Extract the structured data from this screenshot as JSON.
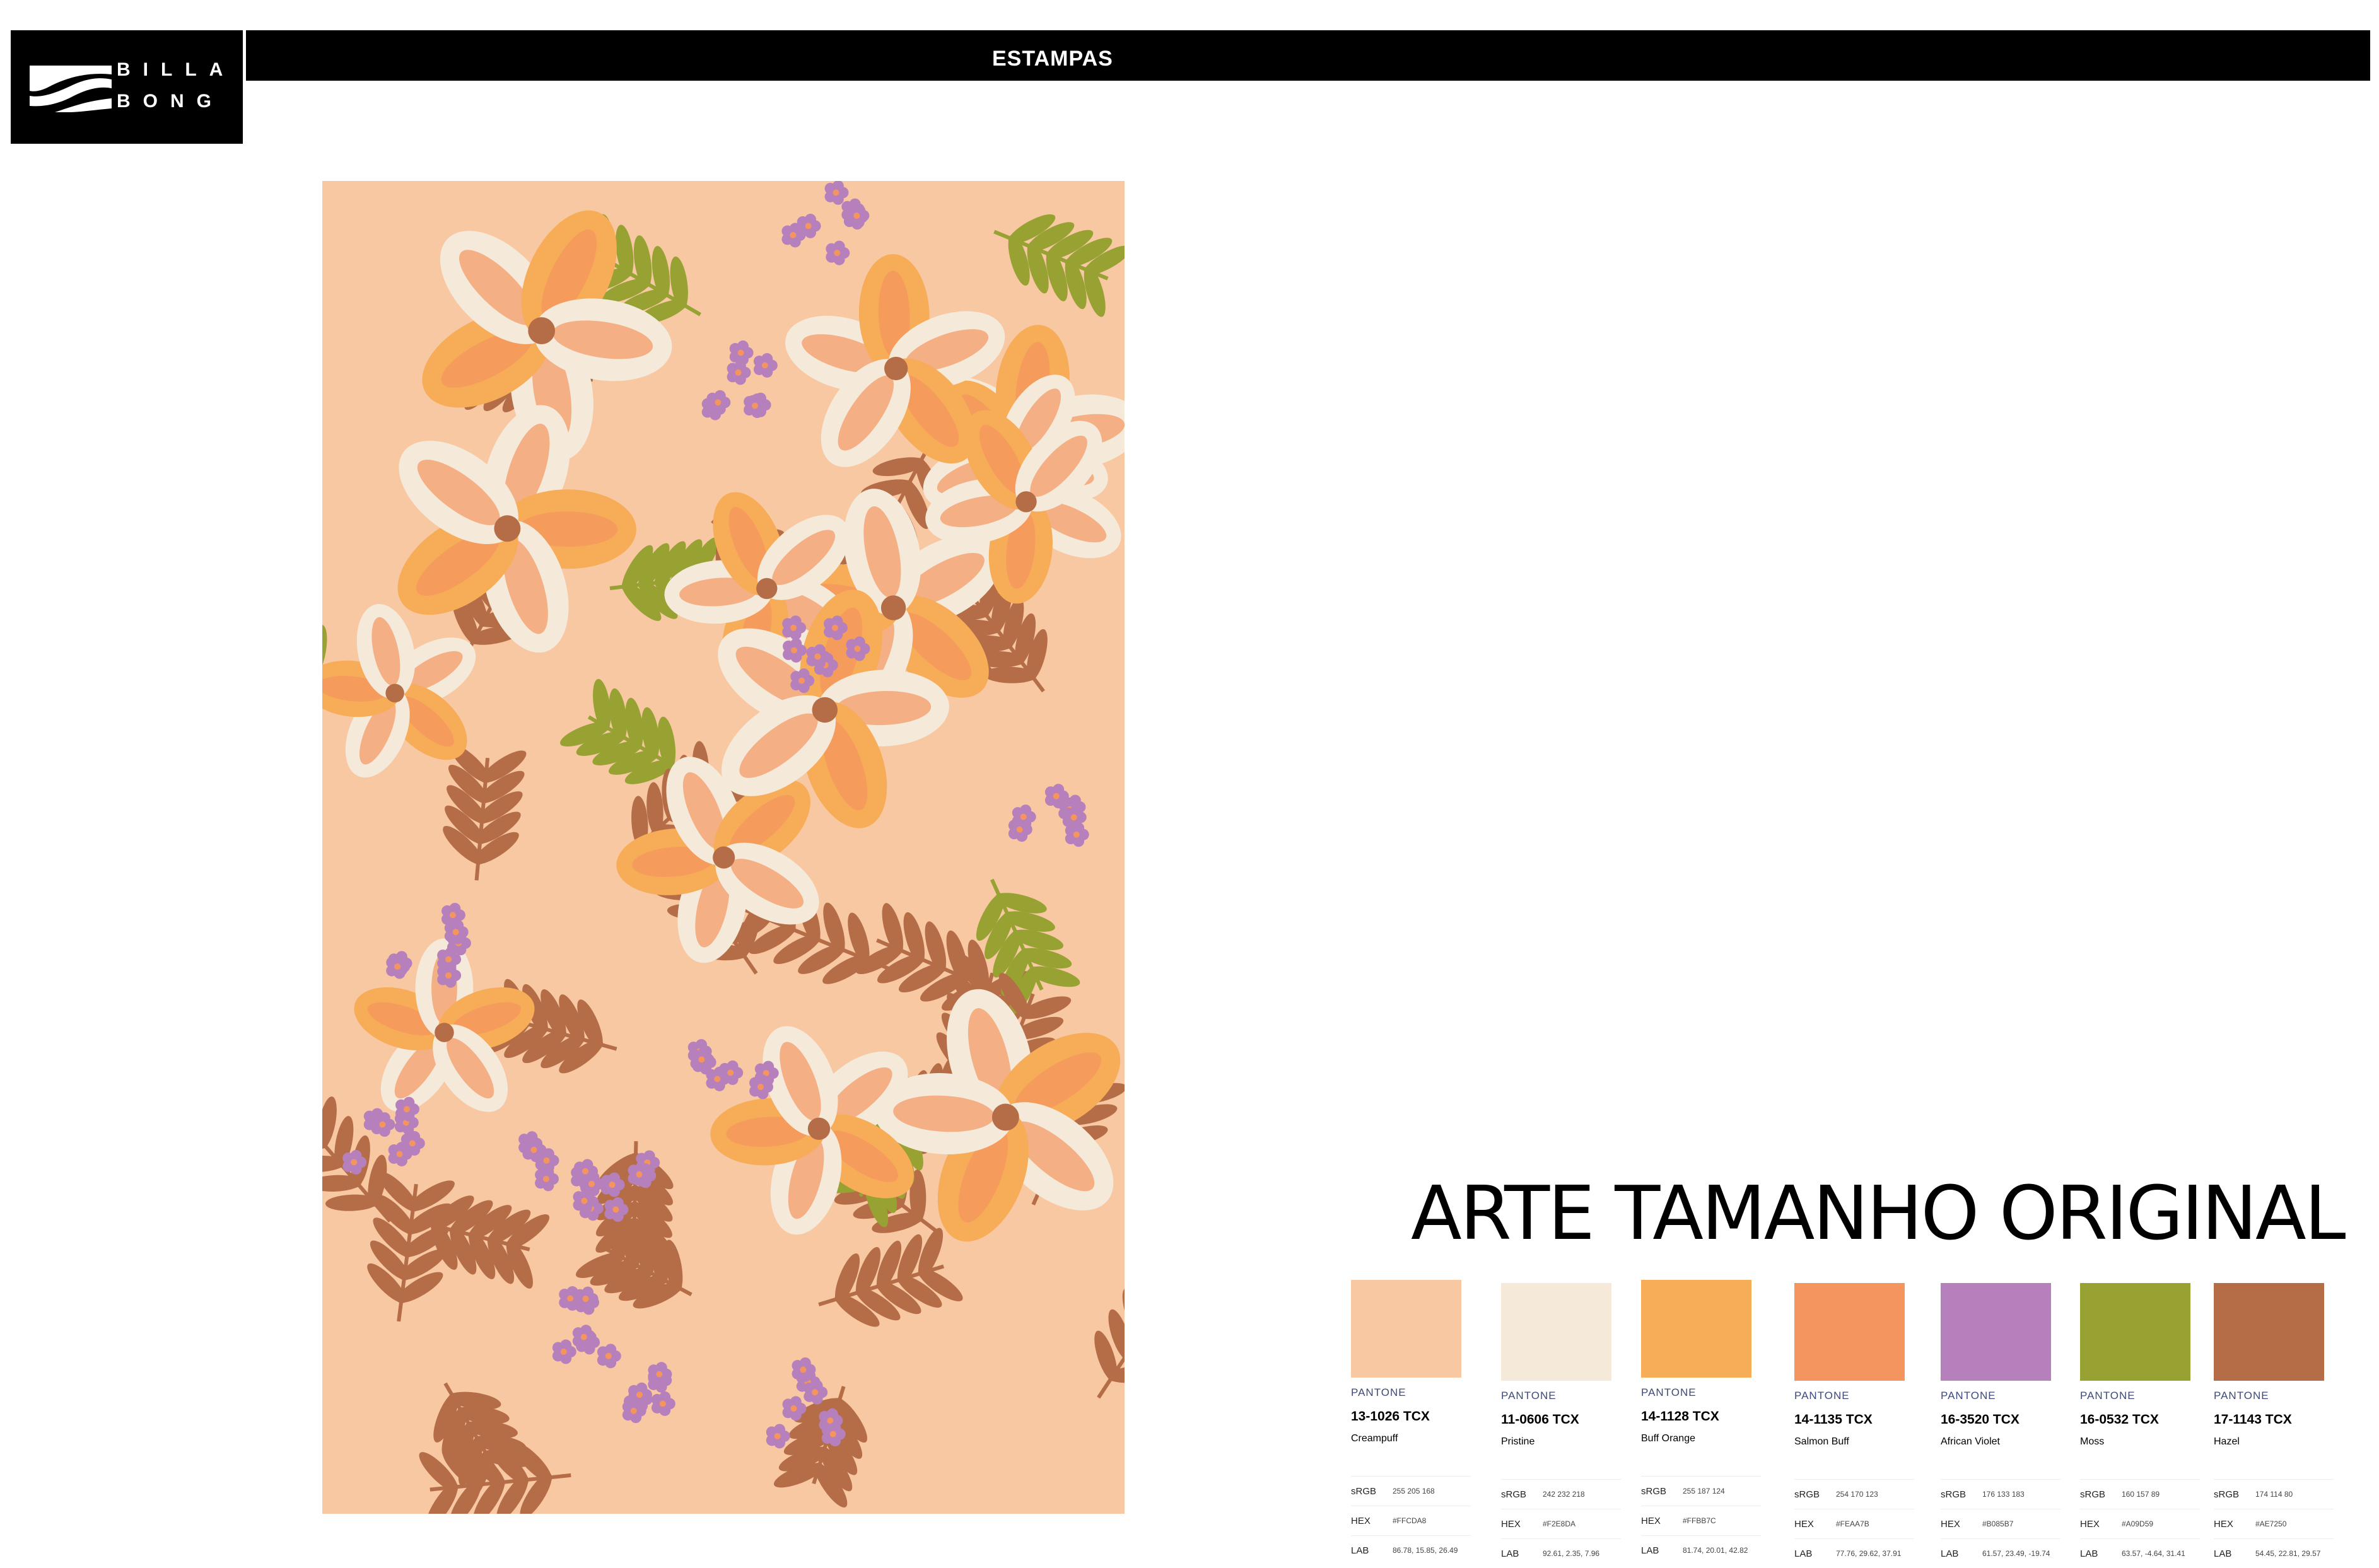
{
  "brand": {
    "line1": "BILLA",
    "line2": "BONG"
  },
  "header": {
    "title": "ESTAMPAS"
  },
  "main": {
    "caption": "ARTE TAMANHO ORIGINAL"
  },
  "palette": [
    {
      "color": "#F8C8A3",
      "pantone": "PANTONE",
      "code": "13-1026 TCX",
      "name": "Creampuff",
      "srgb_label": "sRGB",
      "srgb": "255 205 168",
      "hex_label": "HEX",
      "hex": "#FFCDA8",
      "lab_label": "LAB",
      "lab": "86.78, 15.85, 26.49"
    },
    {
      "color": "#F5E9DA",
      "pantone": "PANTONE",
      "code": "11-0606 TCX",
      "name": "Pristine",
      "srgb_label": "sRGB",
      "srgb": "242 232 218",
      "hex_label": "HEX",
      "hex": "#F2E8DA",
      "lab_label": "LAB",
      "lab": "92.61, 2.35, 7.96"
    },
    {
      "color": "#F7AC58",
      "pantone": "PANTONE",
      "code": "14-1128 TCX",
      "name": "Buff Orange",
      "srgb_label": "sRGB",
      "srgb": "255 187 124",
      "hex_label": "HEX",
      "hex": "#FFBB7C",
      "lab_label": "LAB",
      "lab": "81.74, 20.01, 42.82"
    },
    {
      "color": "#F4955F",
      "pantone": "PANTONE",
      "code": "14-1135 TCX",
      "name": "Salmon Buff",
      "srgb_label": "sRGB",
      "srgb": "254 170 123",
      "hex_label": "HEX",
      "hex": "#FEAA7B",
      "lab_label": "LAB",
      "lab": "77.76, 29.62, 37.91"
    },
    {
      "color": "#B680BC",
      "pantone": "PANTONE",
      "code": "16-3520 TCX",
      "name": "African Violet",
      "srgb_label": "sRGB",
      "srgb": "176 133 183",
      "hex_label": "HEX",
      "hex": "#B085B7",
      "lab_label": "LAB",
      "lab": "61.57, 23.49, -19.74"
    },
    {
      "color": "#97A233",
      "pantone": "PANTONE",
      "code": "16-0532 TCX",
      "name": "Moss",
      "srgb_label": "sRGB",
      "srgb": "160 157 89",
      "hex_label": "HEX",
      "hex": "#A09D59",
      "lab_label": "LAB",
      "lab": "63.57, -4.64, 31.41"
    },
    {
      "color": "#B56D47",
      "pantone": "PANTONE",
      "code": "17-1143 TCX",
      "name": "Hazel",
      "srgb_label": "sRGB",
      "srgb": "174 114 80",
      "hex_label": "HEX",
      "hex": "#AE7250",
      "lab_label": "LAB",
      "lab": "54.45, 22.81, 29.57"
    }
  ]
}
